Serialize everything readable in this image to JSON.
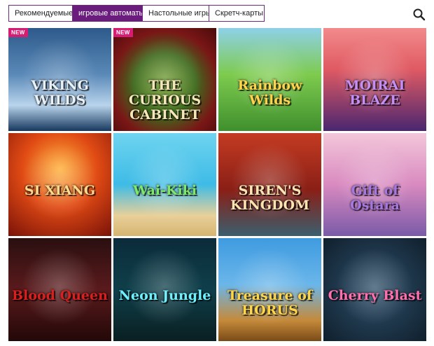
{
  "tabs": [
    {
      "label": "Рекомендуемые",
      "active": false
    },
    {
      "label": "игровые автоматы",
      "active": true
    },
    {
      "label": "Настольные игры",
      "active": false
    },
    {
      "label": "Скретч-карты",
      "active": false
    }
  ],
  "search": {
    "icon": "search-icon"
  },
  "games": [
    {
      "title": "VIKING WILDS",
      "badge": "NEW",
      "bg": "linear-gradient(180deg,#2d5a8a 0%,#5a89b8 45%,#b9d4ec 75%,#17385e 100%)",
      "color": "#e8f0f8"
    },
    {
      "title": "THE CURIOUS CABINET",
      "badge": "NEW",
      "bg": "radial-gradient(circle at 50% 55%,#6f9d2a 0%,#3f6b1e 40%,#7a1616 70%,#4a0b0b 100%)",
      "color": "#f6e7b8"
    },
    {
      "title": "Rainbow Wilds",
      "badge": "",
      "bg": "linear-gradient(180deg,#8ed0e8 0%,#7ecb4e 45%,#3f8f2e 100%)",
      "color": "#ffd34a"
    },
    {
      "title": "MOIRAI BLAZE",
      "badge": "",
      "bg": "linear-gradient(180deg,#f28b8b 0%,#e05a63 40%,#4a2670 100%)",
      "color": "#c68df2"
    },
    {
      "title": "SI XIANG",
      "badge": "",
      "bg": "radial-gradient(circle at 50% 35%,#ffb13a 0%,#e04a14 45%,#7a1208 100%)",
      "color": "#ffd88a"
    },
    {
      "title": "Wai-Kiki",
      "badge": "",
      "bg": "linear-gradient(180deg,#6fd4f0 0%,#3dbbe6 50%,#e8d09a 80%,#d6b470 100%)",
      "color": "#7fe86a"
    },
    {
      "title": "SIREN'S KINGDOM",
      "badge": "",
      "bg": "linear-gradient(180deg,#c43b22 0%,#8a1f16 55%,#3a5f6e 100%)",
      "color": "#ffe3b0"
    },
    {
      "title": "Gift of Ostara",
      "badge": "",
      "bg": "linear-gradient(180deg,#f3c7da 0%,#d98ac0 50%,#7a5aa8 100%)",
      "color": "#a876e0"
    },
    {
      "title": "Blood Queen",
      "badge": "",
      "bg": "linear-gradient(180deg,#2a0f10 0%,#5a1a1c 50%,#230808 100%)",
      "color": "#d9201f"
    },
    {
      "title": "Neon Jungle",
      "badge": "",
      "bg": "linear-gradient(180deg,#0b2b3a 0%,#0f3f4a 50%,#0a1f22 100%)",
      "color": "#6ff0ff"
    },
    {
      "title": "Treasure of HORUS",
      "badge": "",
      "bg": "linear-gradient(180deg,#3f9be0 0%,#6ab6ea 45%,#c58a3a 80%,#7a4a18 100%)",
      "color": "#ffd54a"
    },
    {
      "title": "Cherry Blast",
      "badge": "",
      "bg": "radial-gradient(circle at 50% 50%,#2f4f6a 0%,#1c3346 60%,#0f1f2c 100%)",
      "color": "#ff6fae"
    }
  ]
}
